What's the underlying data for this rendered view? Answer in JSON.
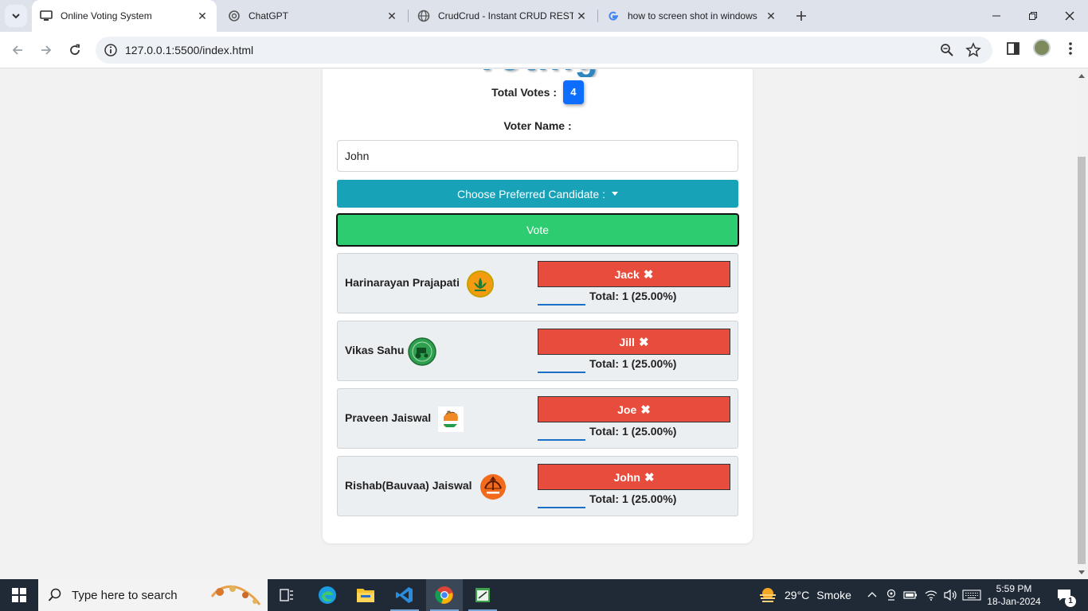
{
  "browser": {
    "tabs": [
      {
        "title": "Online Voting System",
        "active": true
      },
      {
        "title": "ChatGPT",
        "active": false
      },
      {
        "title": "CrudCrud - Instant CRUD REST",
        "active": false
      },
      {
        "title": "how to screen shot in windows",
        "active": false
      }
    ],
    "url": "127.0.0.1:5500/index.html"
  },
  "page": {
    "heading_fragment": "Voting",
    "total_votes_label": "Total Votes :",
    "total_votes": "4",
    "voter_name_label": "Voter Name :",
    "voter_name_value": "John",
    "choose_button": "Choose Preferred Candidate :",
    "vote_button": "Vote",
    "candidates": [
      {
        "name": "Harinarayan Prajapati",
        "voter": "Jack",
        "total": "Total: 1 (25.00%)",
        "share": 0.25
      },
      {
        "name": "Vikas Sahu",
        "voter": "Jill",
        "total": "Total: 1 (25.00%)",
        "share": 0.25
      },
      {
        "name": "Praveen Jaiswal",
        "voter": "Joe",
        "total": "Total: 1 (25.00%)",
        "share": 0.25
      },
      {
        "name": "Rishab(Bauvaa) Jaiswal",
        "voter": "John",
        "total": "Total: 1 (25.00%)",
        "share": 0.25
      }
    ]
  },
  "taskbar": {
    "search_placeholder": "Type here to search",
    "weather_temp": "29°C",
    "weather_desc": "Smoke",
    "time": "5:59 PM",
    "date": "18-Jan-2024",
    "notification_count": "1"
  },
  "colors": {
    "choose_button": "#17a2b8",
    "vote_button": "#2ecc71",
    "voter_tag": "#e74c3c",
    "badge": "#0d6efd"
  }
}
